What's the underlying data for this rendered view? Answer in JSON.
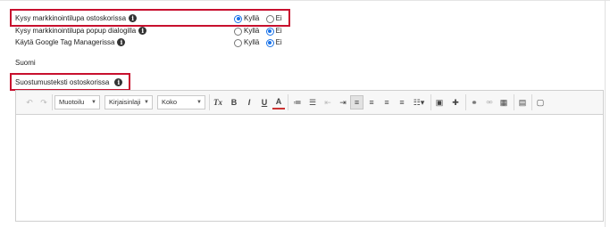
{
  "settings": [
    {
      "label": "Kysy markkinointilupa ostoskorissa",
      "options": [
        {
          "label": "Kyllä",
          "selected": true
        },
        {
          "label": "Ei",
          "selected": false
        }
      ]
    },
    {
      "label": "Kysy markkinointilupa popup dialogilla",
      "options": [
        {
          "label": "Kyllä",
          "selected": false
        },
        {
          "label": "Ei",
          "selected": true
        }
      ]
    },
    {
      "label": "Käytä Google Tag Managerissa",
      "options": [
        {
          "label": "Kyllä",
          "selected": false
        },
        {
          "label": "Ei",
          "selected": true
        }
      ]
    }
  ],
  "info_glyph": "i",
  "language_heading": "Suomi",
  "consent_text_label": "Suostumusteksti ostoskorissa",
  "toolbar": {
    "format_combo": "Muotoilu",
    "font_combo": "Kirjaisinlaji",
    "size_combo": "Koko",
    "bold": "B",
    "italic": "I",
    "underline": "U",
    "text_color": "A",
    "remove_format": "Tx",
    "combo_arrow": "▼",
    "buttons": [
      {
        "name": "undo-icon",
        "glyph": "↶"
      },
      {
        "name": "redo-icon",
        "glyph": "↷"
      },
      {
        "name": "numbered-list-icon",
        "glyph": "≔"
      },
      {
        "name": "bulleted-list-icon",
        "glyph": "☰"
      },
      {
        "name": "outdent-icon",
        "glyph": "⇤"
      },
      {
        "name": "indent-icon",
        "glyph": "⇥"
      },
      {
        "name": "align-left-icon",
        "glyph": "≡"
      },
      {
        "name": "align-center-icon",
        "glyph": "≡"
      },
      {
        "name": "align-right-icon",
        "glyph": "≡"
      },
      {
        "name": "align-justify-icon",
        "glyph": "≡"
      },
      {
        "name": "line-height-icon",
        "glyph": "☷▾"
      },
      {
        "name": "image-icon",
        "glyph": "▣"
      },
      {
        "name": "puzzle-icon",
        "glyph": "✚"
      },
      {
        "name": "link-icon",
        "glyph": "⚭"
      },
      {
        "name": "unlink-icon",
        "glyph": "⚮"
      },
      {
        "name": "table-icon",
        "glyph": "▦"
      },
      {
        "name": "source-icon",
        "glyph": "▤"
      },
      {
        "name": "maximize-icon",
        "glyph": "▢"
      }
    ]
  },
  "colors": {
    "highlight_border": "#c8102e",
    "radio_selected": "#1a73e8"
  }
}
